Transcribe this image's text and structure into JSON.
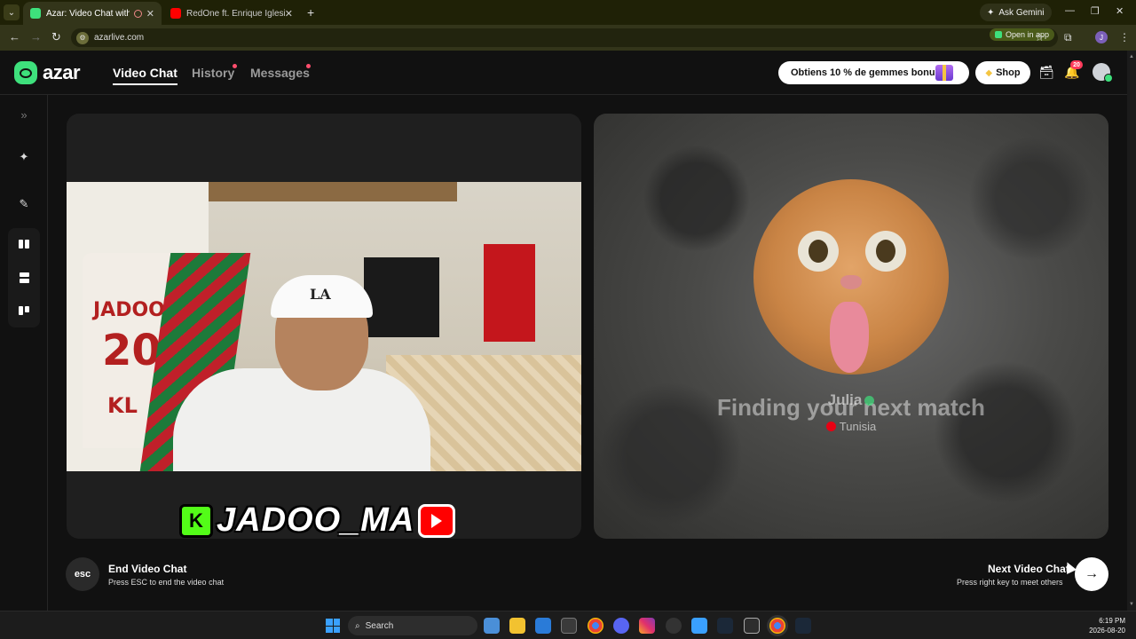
{
  "browser": {
    "tabs": [
      {
        "title": "Azar: Video Chat with New",
        "active": true
      },
      {
        "title": "RedOne ft. Enrique Iglesias, Ase",
        "active": false
      }
    ],
    "new_tab_icon": "+",
    "ask_gemini": "Ask Gemini",
    "url": "azarlive.com",
    "open_in_app": "Open in app",
    "profile_initial": "J"
  },
  "header": {
    "logo_text": "azar",
    "nav": {
      "video_chat": "Video Chat",
      "history": "History",
      "messages": "Messages"
    },
    "promo": "Obtiens 10 % de gemmes bonus !",
    "shop": "Shop",
    "notification_count": "20"
  },
  "colors": {
    "brand_green": "#3ee07c",
    "notification_red": "#ff3b5c"
  },
  "sidebar": {
    "icons": [
      "expand-icon",
      "magic-wand-icon",
      "edit-icon",
      "layout-side-by-side-icon",
      "layout-stacked-icon",
      "layout-grid-icon"
    ]
  },
  "left_panel": {
    "streamer_tag": "JADOO_MA",
    "kick_letter": "K",
    "jersey_name": "JADOO",
    "jersey_number": "20",
    "jersey_initials": "KL",
    "cap_logo": "LA"
  },
  "right_panel": {
    "status": "Finding your next match",
    "match_name": "Julia",
    "match_country": "Tunisia"
  },
  "controls": {
    "esc_key": "esc",
    "end_title": "End Video Chat",
    "end_sub": "Press ESC to end the video chat",
    "next_title": "Next Video Chat",
    "next_sub": "Press right key to meet others",
    "next_arrow": "→"
  },
  "taskbar": {
    "search": "Search",
    "time": "6:19 PM",
    "date": "2026-08-20"
  }
}
